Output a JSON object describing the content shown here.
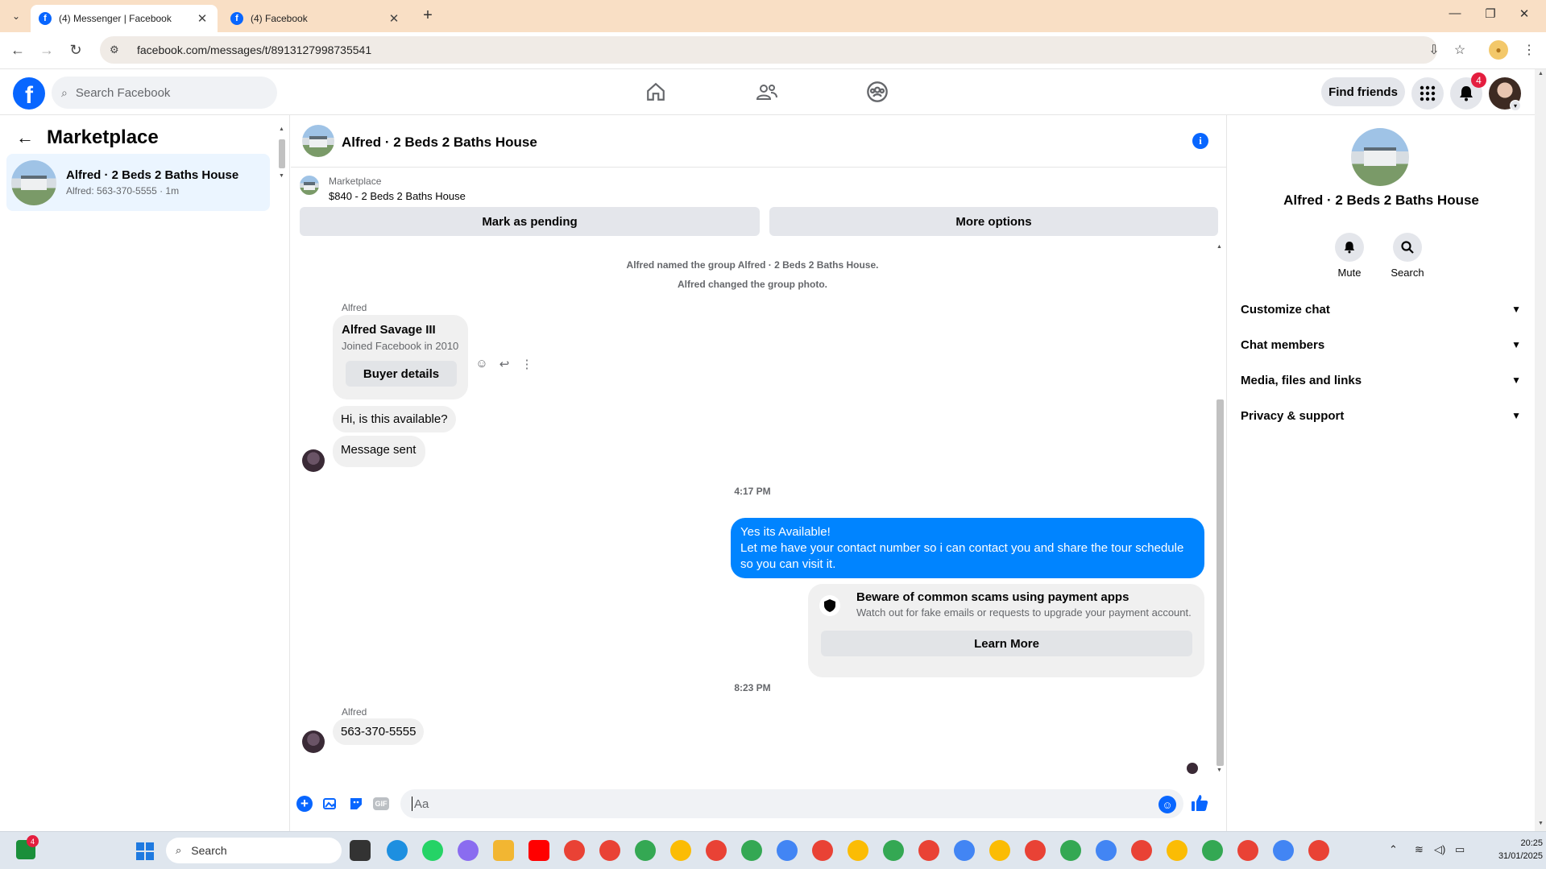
{
  "browser": {
    "tabs": [
      {
        "title": "(4) Messenger | Facebook",
        "active": true
      },
      {
        "title": "(4) Facebook",
        "active": false
      }
    ],
    "url": "facebook.com/messages/t/8913127998735541"
  },
  "fb_header": {
    "search_placeholder": "Search Facebook",
    "find_friends_label": "Find friends",
    "notification_count": "4",
    "logo_letter": "f"
  },
  "left_pane": {
    "title": "Marketplace",
    "conversation": {
      "name": "Alfred · 2 Beds 2 Baths House",
      "preview": "Alfred: 563-370-5555 · 1m"
    }
  },
  "chat": {
    "title": "Alfred · 2 Beds 2 Baths House",
    "listing": {
      "source": "Marketplace",
      "price_title": "$840 - 2 Beds 2 Baths House",
      "mark_pending_label": "Mark as pending",
      "more_options_label": "More options"
    },
    "system_messages": [
      "Alfred named the group Alfred · 2 Beds 2 Baths House.",
      "Alfred changed the group photo."
    ],
    "sender_name": "Alfred",
    "buyer_card": {
      "name": "Alfred Savage III",
      "joined": "Joined Facebook in 2010",
      "button": "Buyer details"
    },
    "incoming_1": "Hi, is this available?",
    "incoming_2": "Message sent",
    "time_1": "4:17 PM",
    "outgoing_lines": [
      "Yes its Available!",
      "Let me have your contact number so i can contact you and share the tour schedule",
      "so you can visit it."
    ],
    "scam_notice": {
      "title": "Beware of common scams using payment apps",
      "body": "Watch out for fake emails or requests to upgrade your payment account.",
      "button": "Learn More"
    },
    "time_2": "8:23 PM",
    "sender_name_2": "Alfred",
    "incoming_3": "563-370-5555",
    "composer_placeholder": "Aa",
    "gif_label": "GIF"
  },
  "info_pane": {
    "title": "Alfred · 2 Beds 2 Baths House",
    "actions": [
      {
        "label": "Mute",
        "icon": "bell-icon"
      },
      {
        "label": "Search",
        "icon": "search-icon"
      }
    ],
    "sections": [
      "Customize chat",
      "Chat members",
      "Media, files and links",
      "Privacy & support"
    ]
  },
  "taskbar": {
    "widget_badge": "4",
    "search_label": "Search",
    "time": "20:25",
    "date": "31/01/2025"
  },
  "colors": {
    "accent": "#0866ff",
    "my_bubble": "#0084ff",
    "tab_bar": "#f9dfc5",
    "selected_conversation": "#ebf5ff"
  }
}
